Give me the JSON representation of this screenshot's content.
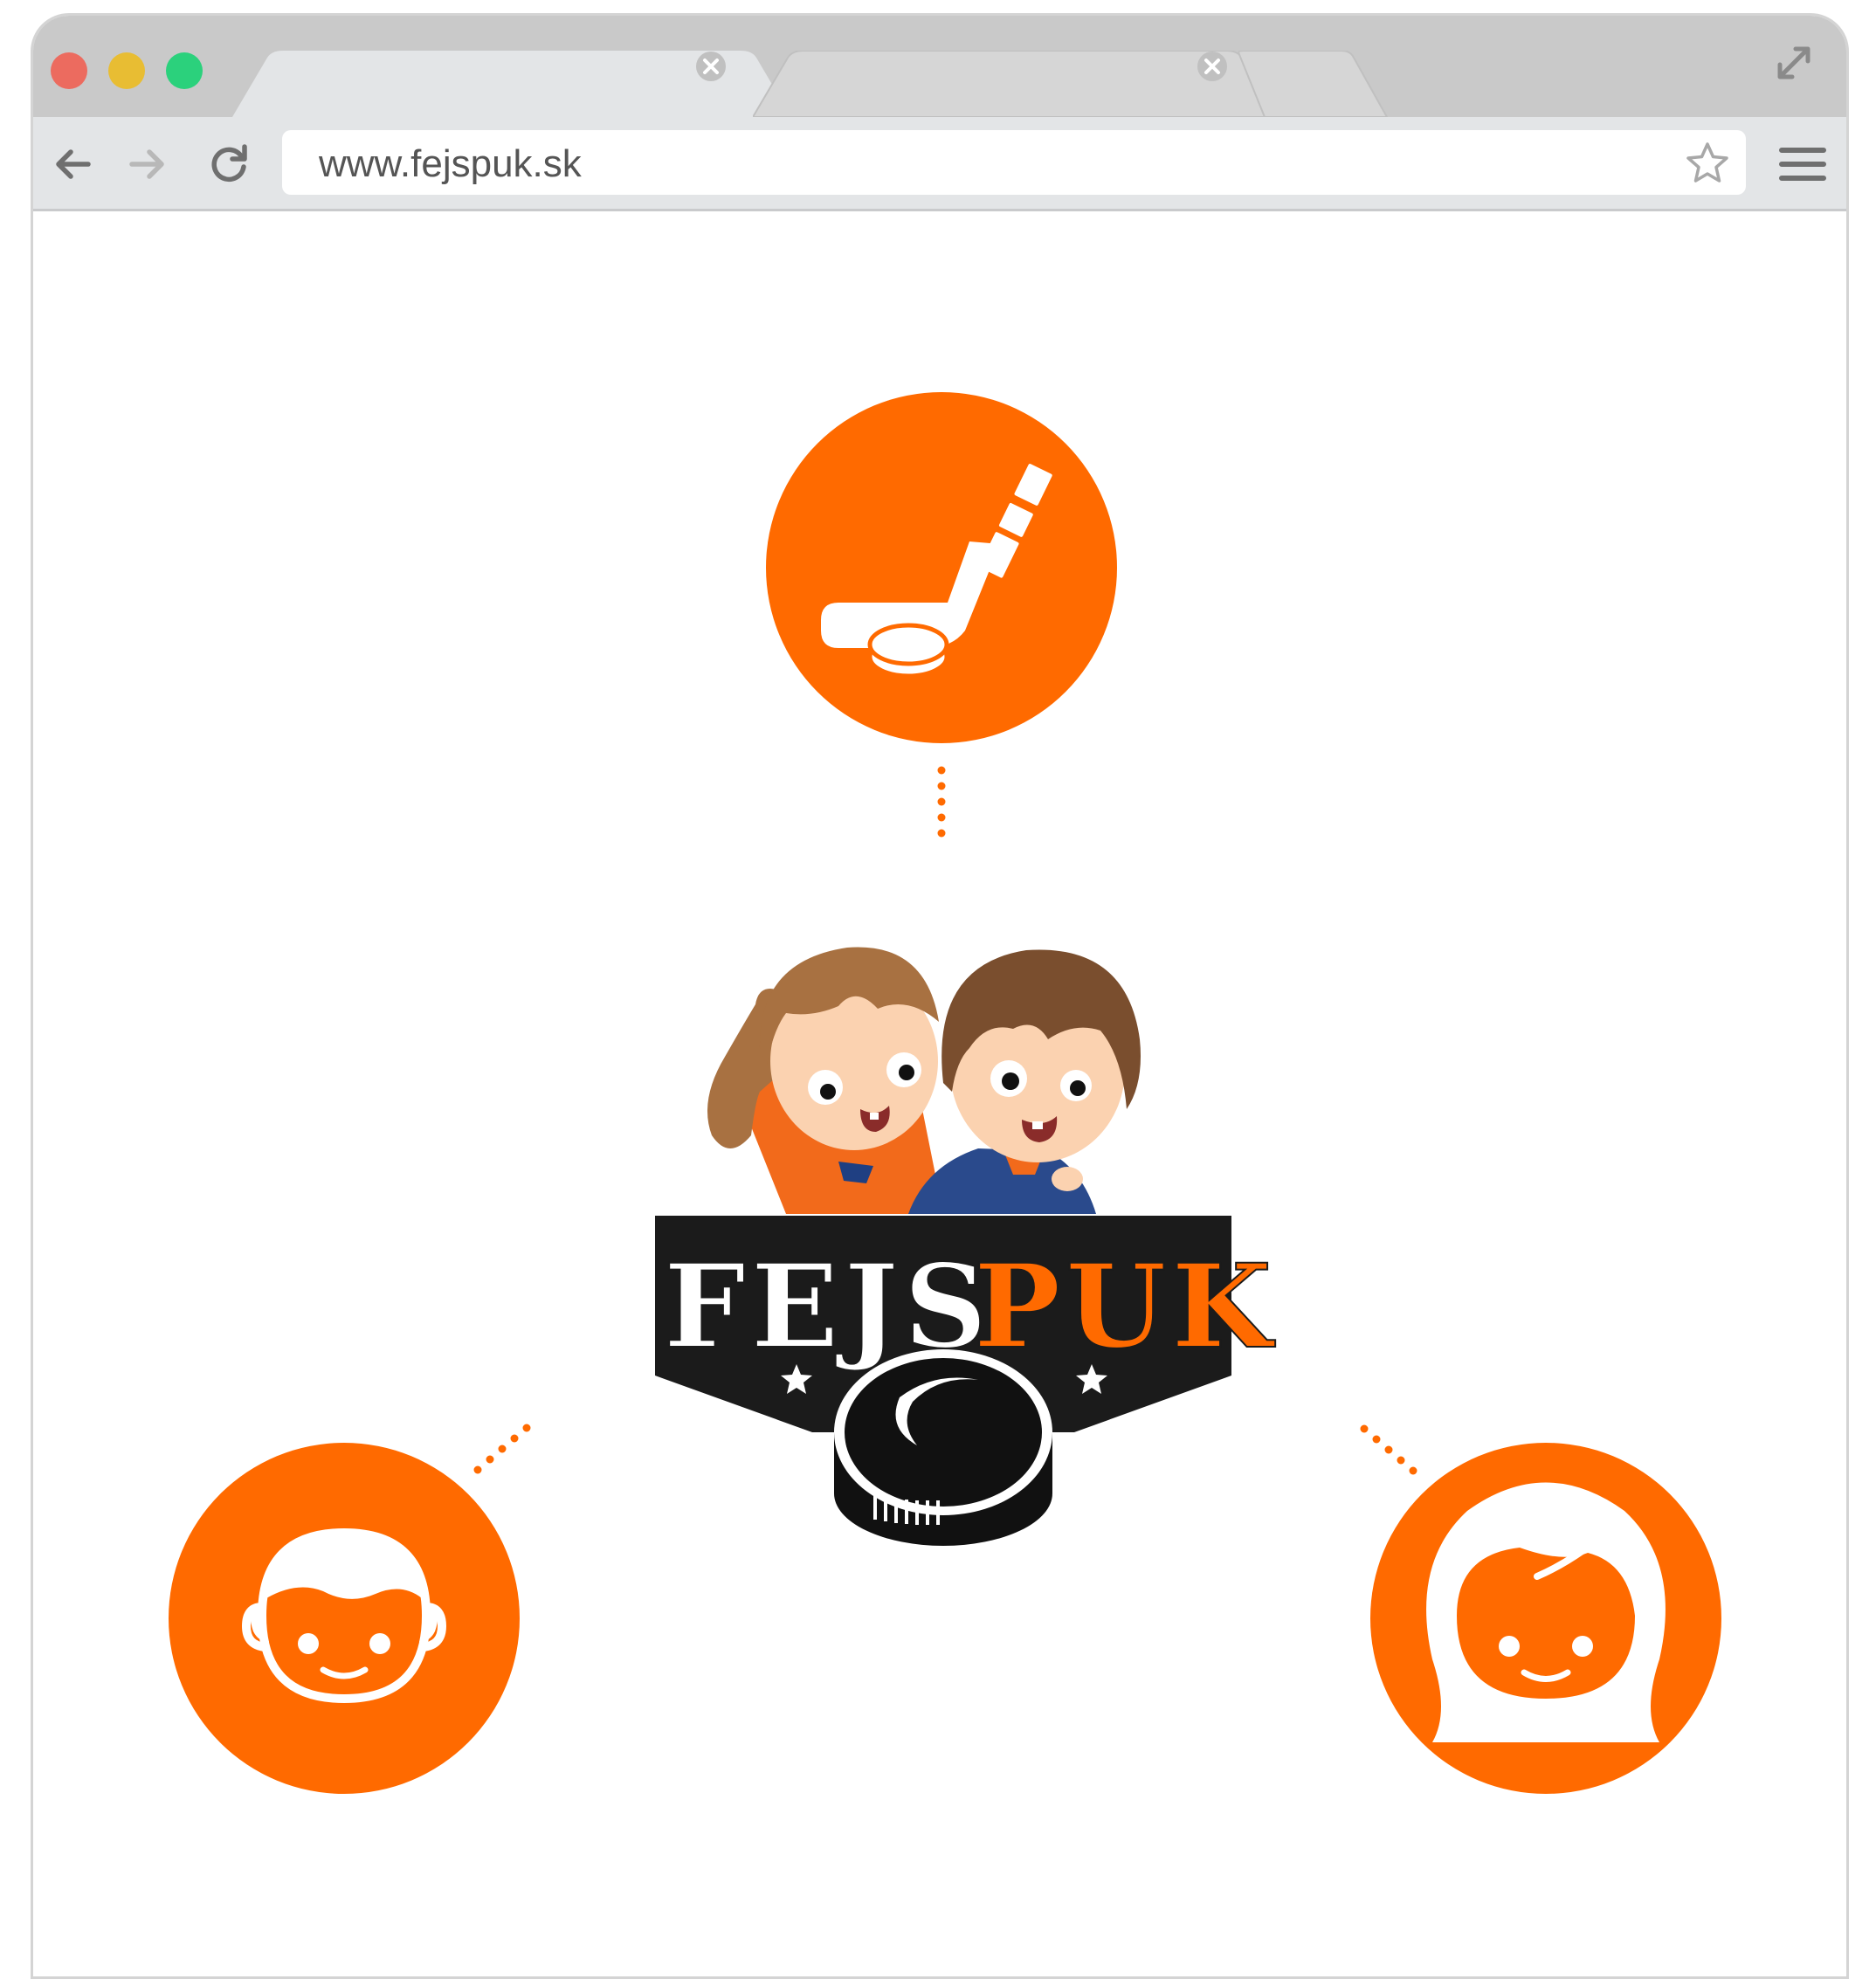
{
  "browser": {
    "address_url": "www.fejspuk.sk"
  },
  "logo": {
    "word_part1": "FEJS",
    "word_part2": "PUK"
  },
  "icons": {
    "top": "hockey-stick-and-puck-icon",
    "left": "boy-face-icon",
    "right": "girl-face-icon"
  },
  "colors": {
    "accent": "#ff6a00",
    "logo_black": "#1b1b1b",
    "jersey_blue": "#2a4a8c"
  }
}
